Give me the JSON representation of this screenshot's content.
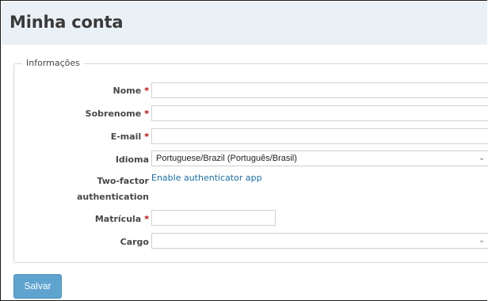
{
  "page": {
    "title": "Minha conta"
  },
  "form": {
    "legend": "Informações",
    "required_marker": "*",
    "fields": {
      "first_name": {
        "label": "Nome",
        "value": ""
      },
      "last_name": {
        "label": "Sobrenome",
        "value": ""
      },
      "email": {
        "label": "E-mail",
        "value": ""
      },
      "language": {
        "label": "Idioma",
        "value": "Portuguese/Brazil (Português/Brasil)"
      },
      "two_factor": {
        "label_line1": "Two-factor",
        "label_line2": "authentication",
        "link": "Enable authenticator app"
      },
      "registration": {
        "label": "Matrícula",
        "value": ""
      },
      "role": {
        "label": "Cargo",
        "value": ""
      }
    },
    "save_label": "Salvar"
  },
  "icons": {
    "select_arrow": "chevron-down-icon"
  }
}
